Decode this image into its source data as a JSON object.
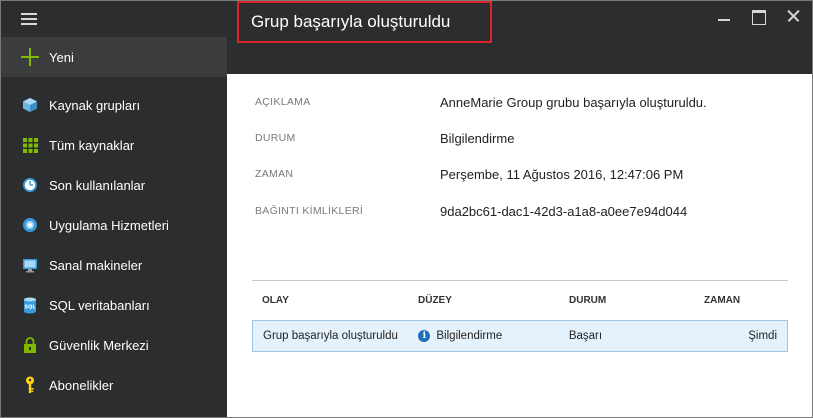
{
  "window": {
    "title": "Grup başarıyla oluşturuldu"
  },
  "sidebar": {
    "new_label": "Yeni",
    "items": [
      {
        "label": "Kaynak grupları",
        "icon": "resource-groups-icon"
      },
      {
        "label": "Tüm kaynaklar",
        "icon": "all-resources-icon"
      },
      {
        "label": "Son kullanılanlar",
        "icon": "recent-clock-icon"
      },
      {
        "label": "Uygulama Hizmetleri",
        "icon": "app-services-icon"
      },
      {
        "label": "Sanal makineler",
        "icon": "virtual-machine-icon"
      },
      {
        "label": "SQL veritabanları",
        "icon": "sql-database-icon"
      },
      {
        "label": "Güvenlik Merkezi",
        "icon": "security-lock-icon"
      },
      {
        "label": "Abonelikler",
        "icon": "subscription-key-icon"
      }
    ]
  },
  "details": [
    {
      "key": "AÇIKLAMA",
      "value": "AnneMarie Group grubu başarıyla oluşturuldu."
    },
    {
      "key": "DURUM",
      "value": "Bilgilendirme"
    },
    {
      "key": "ZAMAN",
      "value": "Perşembe, 11 Ağustos 2016, 12:47:06 PM"
    },
    {
      "key": "BAĞINTI KİMLİKLERİ",
      "value": "9da2bc61-dac1-42d3-a1a8-a0ee7e94d044"
    }
  ],
  "events_table": {
    "headers": [
      "OLAY",
      "DÜZEY",
      "DURUM",
      "ZAMAN"
    ],
    "rows": [
      {
        "event": "Grup başarıyla oluşturuldu",
        "level": "Bilgilendirme",
        "status": "Başarı",
        "time": "Şimdi"
      }
    ]
  },
  "colors": {
    "chrome_dark": "#2b2d2f",
    "accent_green": "#7fba00",
    "highlight_red": "#d9232d",
    "row_selected": "#e6f2fb",
    "info_blue": "#1e6fb8"
  }
}
